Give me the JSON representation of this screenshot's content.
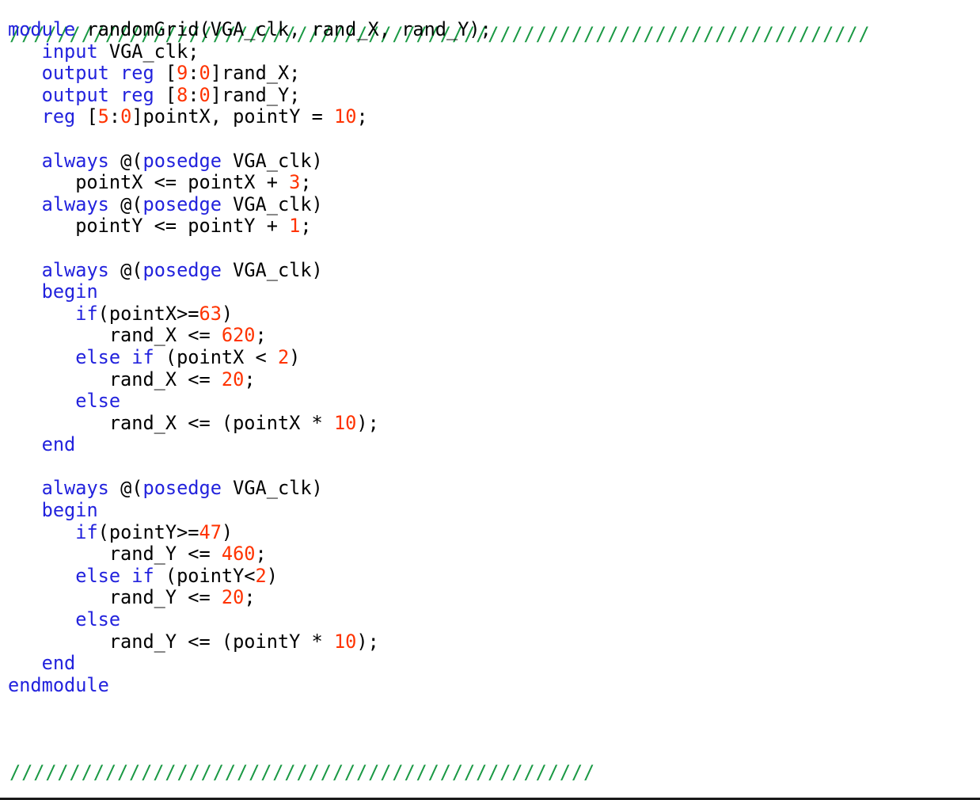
{
  "document": {
    "language": "verilog",
    "module_name": "randomGrid",
    "colors": {
      "background": "#ffffff",
      "keyword": "#2222dd",
      "number": "#ff3300",
      "identifier": "#000000",
      "comment": "#1a9944",
      "border": "#1a1a1a"
    }
  },
  "comment_banner": {
    "top": "////////////////////////////////////////////////////////////////////////",
    "bottom": "/////////////////////////////////////////////////"
  },
  "code": {
    "lines": [
      {
        "index": 1,
        "text": "module randomGrid(VGA_clk, rand_X, rand_Y);",
        "tokens": [
          {
            "t": "module",
            "c": "kw"
          },
          {
            "t": " randomGrid(VGA_clk, rand_X, rand_Y);",
            "c": "plain"
          }
        ]
      },
      {
        "index": 2,
        "text": "   input VGA_clk;",
        "tokens": [
          {
            "t": "   ",
            "c": "plain"
          },
          {
            "t": "input",
            "c": "kw"
          },
          {
            "t": " VGA_clk;",
            "c": "plain"
          }
        ]
      },
      {
        "index": 3,
        "text": "   output reg [9:0]rand_X;",
        "tokens": [
          {
            "t": "   ",
            "c": "plain"
          },
          {
            "t": "output reg",
            "c": "kw"
          },
          {
            "t": " [",
            "c": "plain"
          },
          {
            "t": "9",
            "c": "num"
          },
          {
            "t": ":",
            "c": "plain"
          },
          {
            "t": "0",
            "c": "num"
          },
          {
            "t": "]rand_X;",
            "c": "plain"
          }
        ]
      },
      {
        "index": 4,
        "text": "   output reg [8:0]rand_Y;",
        "tokens": [
          {
            "t": "   ",
            "c": "plain"
          },
          {
            "t": "output reg",
            "c": "kw"
          },
          {
            "t": " [",
            "c": "plain"
          },
          {
            "t": "8",
            "c": "num"
          },
          {
            "t": ":",
            "c": "plain"
          },
          {
            "t": "0",
            "c": "num"
          },
          {
            "t": "]rand_Y;",
            "c": "plain"
          }
        ]
      },
      {
        "index": 5,
        "text": "   reg [5:0]pointX, pointY = 10;",
        "tokens": [
          {
            "t": "   ",
            "c": "plain"
          },
          {
            "t": "reg",
            "c": "kw"
          },
          {
            "t": " [",
            "c": "plain"
          },
          {
            "t": "5",
            "c": "num"
          },
          {
            "t": ":",
            "c": "plain"
          },
          {
            "t": "0",
            "c": "num"
          },
          {
            "t": "]pointX, pointY = ",
            "c": "plain"
          },
          {
            "t": "10",
            "c": "num"
          },
          {
            "t": ";",
            "c": "plain"
          }
        ]
      },
      {
        "index": 6,
        "text": "",
        "tokens": []
      },
      {
        "index": 7,
        "text": "   always @(posedge VGA_clk)",
        "tokens": [
          {
            "t": "   ",
            "c": "plain"
          },
          {
            "t": "always",
            "c": "kw"
          },
          {
            "t": " @(",
            "c": "plain"
          },
          {
            "t": "posedge",
            "c": "kw"
          },
          {
            "t": " VGA_clk)",
            "c": "plain"
          }
        ]
      },
      {
        "index": 8,
        "text": "      pointX <= pointX + 3;",
        "tokens": [
          {
            "t": "      pointX <= pointX + ",
            "c": "plain"
          },
          {
            "t": "3",
            "c": "num"
          },
          {
            "t": ";",
            "c": "plain"
          }
        ]
      },
      {
        "index": 9,
        "text": "   always @(posedge VGA_clk)",
        "tokens": [
          {
            "t": "   ",
            "c": "plain"
          },
          {
            "t": "always",
            "c": "kw"
          },
          {
            "t": " @(",
            "c": "plain"
          },
          {
            "t": "posedge",
            "c": "kw"
          },
          {
            "t": " VGA_clk)",
            "c": "plain"
          }
        ]
      },
      {
        "index": 10,
        "text": "      pointY <= pointY + 1;",
        "tokens": [
          {
            "t": "      pointY <= pointY + ",
            "c": "plain"
          },
          {
            "t": "1",
            "c": "num"
          },
          {
            "t": ";",
            "c": "plain"
          }
        ]
      },
      {
        "index": 11,
        "text": "",
        "tokens": []
      },
      {
        "index": 12,
        "text": "   always @(posedge VGA_clk)",
        "tokens": [
          {
            "t": "   ",
            "c": "plain"
          },
          {
            "t": "always",
            "c": "kw"
          },
          {
            "t": " @(",
            "c": "plain"
          },
          {
            "t": "posedge",
            "c": "kw"
          },
          {
            "t": " VGA_clk)",
            "c": "plain"
          }
        ]
      },
      {
        "index": 13,
        "text": "   begin",
        "tokens": [
          {
            "t": "   ",
            "c": "plain"
          },
          {
            "t": "begin",
            "c": "kw"
          }
        ]
      },
      {
        "index": 14,
        "text": "      if(pointX>=63)",
        "tokens": [
          {
            "t": "      ",
            "c": "plain"
          },
          {
            "t": "if",
            "c": "kw"
          },
          {
            "t": "(pointX>=",
            "c": "plain"
          },
          {
            "t": "63",
            "c": "num"
          },
          {
            "t": ")",
            "c": "plain"
          }
        ]
      },
      {
        "index": 15,
        "text": "         rand_X <= 620;",
        "tokens": [
          {
            "t": "         rand_X <= ",
            "c": "plain"
          },
          {
            "t": "620",
            "c": "num"
          },
          {
            "t": ";",
            "c": "plain"
          }
        ]
      },
      {
        "index": 16,
        "text": "      else if (pointX < 2)",
        "tokens": [
          {
            "t": "      ",
            "c": "plain"
          },
          {
            "t": "else if",
            "c": "kw"
          },
          {
            "t": " (pointX < ",
            "c": "plain"
          },
          {
            "t": "2",
            "c": "num"
          },
          {
            "t": ")",
            "c": "plain"
          }
        ]
      },
      {
        "index": 17,
        "text": "         rand_X <= 20;",
        "tokens": [
          {
            "t": "         rand_X <= ",
            "c": "plain"
          },
          {
            "t": "20",
            "c": "num"
          },
          {
            "t": ";",
            "c": "plain"
          }
        ]
      },
      {
        "index": 18,
        "text": "      else",
        "tokens": [
          {
            "t": "      ",
            "c": "plain"
          },
          {
            "t": "else",
            "c": "kw"
          }
        ]
      },
      {
        "index": 19,
        "text": "         rand_X <= (pointX * 10);",
        "tokens": [
          {
            "t": "         rand_X <= (pointX * ",
            "c": "plain"
          },
          {
            "t": "10",
            "c": "num"
          },
          {
            "t": ");",
            "c": "plain"
          }
        ]
      },
      {
        "index": 20,
        "text": "   end",
        "tokens": [
          {
            "t": "   ",
            "c": "plain"
          },
          {
            "t": "end",
            "c": "kw"
          }
        ]
      },
      {
        "index": 21,
        "text": "",
        "tokens": []
      },
      {
        "index": 22,
        "text": "   always @(posedge VGA_clk)",
        "tokens": [
          {
            "t": "   ",
            "c": "plain"
          },
          {
            "t": "always",
            "c": "kw"
          },
          {
            "t": " @(",
            "c": "plain"
          },
          {
            "t": "posedge",
            "c": "kw"
          },
          {
            "t": " VGA_clk)",
            "c": "plain"
          }
        ]
      },
      {
        "index": 23,
        "text": "   begin",
        "tokens": [
          {
            "t": "   ",
            "c": "plain"
          },
          {
            "t": "begin",
            "c": "kw"
          }
        ]
      },
      {
        "index": 24,
        "text": "      if(pointY>=47)",
        "tokens": [
          {
            "t": "      ",
            "c": "plain"
          },
          {
            "t": "if",
            "c": "kw"
          },
          {
            "t": "(pointY>=",
            "c": "plain"
          },
          {
            "t": "47",
            "c": "num"
          },
          {
            "t": ")",
            "c": "plain"
          }
        ]
      },
      {
        "index": 25,
        "text": "         rand_Y <= 460;",
        "tokens": [
          {
            "t": "         rand_Y <= ",
            "c": "plain"
          },
          {
            "t": "460",
            "c": "num"
          },
          {
            "t": ";",
            "c": "plain"
          }
        ]
      },
      {
        "index": 26,
        "text": "      else if (pointY<2)",
        "tokens": [
          {
            "t": "      ",
            "c": "plain"
          },
          {
            "t": "else if",
            "c": "kw"
          },
          {
            "t": " (pointY<",
            "c": "plain"
          },
          {
            "t": "2",
            "c": "num"
          },
          {
            "t": ")",
            "c": "plain"
          }
        ]
      },
      {
        "index": 27,
        "text": "         rand_Y <= 20;",
        "tokens": [
          {
            "t": "         rand_Y <= ",
            "c": "plain"
          },
          {
            "t": "20",
            "c": "num"
          },
          {
            "t": ";",
            "c": "plain"
          }
        ]
      },
      {
        "index": 28,
        "text": "      else",
        "tokens": [
          {
            "t": "      ",
            "c": "plain"
          },
          {
            "t": "else",
            "c": "kw"
          }
        ]
      },
      {
        "index": 29,
        "text": "         rand_Y <= (pointY * 10);",
        "tokens": [
          {
            "t": "         rand_Y <= (pointY * ",
            "c": "plain"
          },
          {
            "t": "10",
            "c": "num"
          },
          {
            "t": ");",
            "c": "plain"
          }
        ]
      },
      {
        "index": 30,
        "text": "   end",
        "tokens": [
          {
            "t": "   ",
            "c": "plain"
          },
          {
            "t": "end",
            "c": "kw"
          }
        ]
      },
      {
        "index": 31,
        "text": "endmodule",
        "tokens": [
          {
            "t": "endmodule",
            "c": "kw"
          }
        ]
      }
    ]
  }
}
